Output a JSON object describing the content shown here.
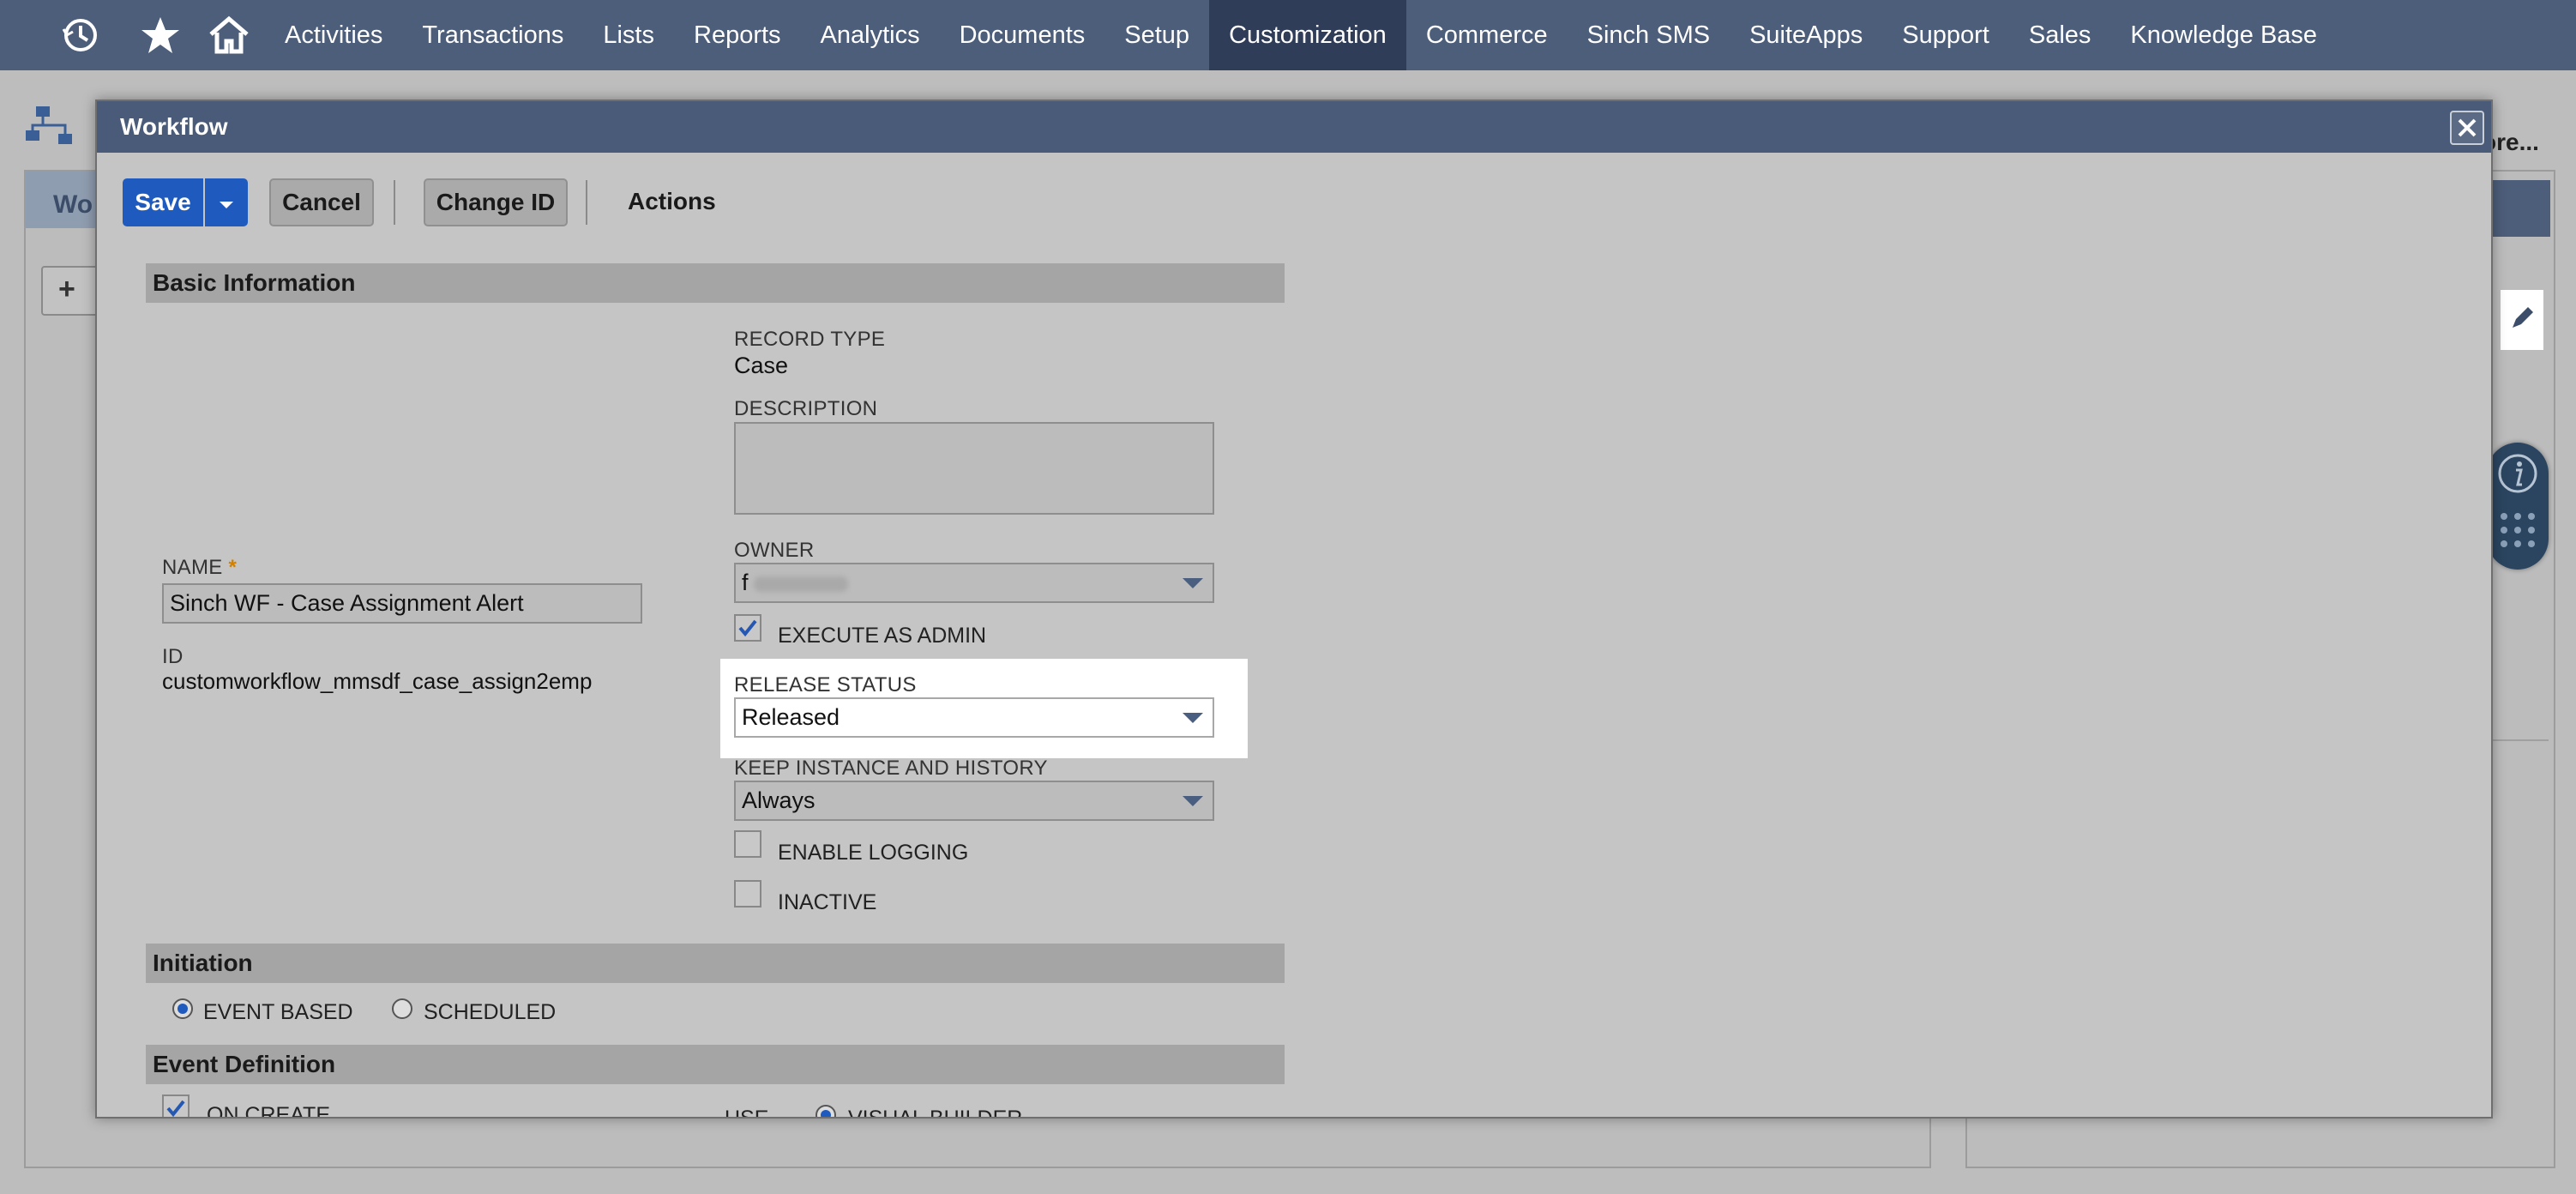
{
  "nav": {
    "items": [
      "Activities",
      "Transactions",
      "Lists",
      "Reports",
      "Analytics",
      "Documents",
      "Setup",
      "Customization",
      "Commerce",
      "Sinch SMS",
      "SuiteApps",
      "Support",
      "Sales",
      "Knowledge Base"
    ],
    "active": "Customization"
  },
  "background": {
    "tab_partial": "Wo",
    "more_partial": "ore..."
  },
  "modal": {
    "title": "Workflow",
    "toolbar": {
      "save": "Save",
      "cancel": "Cancel",
      "change_id": "Change ID",
      "actions": "Actions"
    },
    "sections": {
      "basic": "Basic Information",
      "initiation": "Initiation",
      "event_definition": "Event Definition"
    },
    "fields": {
      "name_label": "NAME",
      "name_required": "*",
      "name_value": "Sinch WF - Case Assignment Alert",
      "id_label": "ID",
      "id_value": "customworkflow_mmsdf_case_assign2emp",
      "record_type_label": "RECORD TYPE",
      "record_type_value": "Case",
      "description_label": "DESCRIPTION",
      "description_value": "",
      "owner_label": "OWNER",
      "owner_value": "f",
      "execute_as_admin": "EXECUTE AS ADMIN",
      "execute_as_admin_checked": true,
      "release_status_label": "RELEASE STATUS",
      "release_status_value": "Released",
      "keep_instance_label": "KEEP INSTANCE AND HISTORY",
      "keep_instance_value": "Always",
      "enable_logging": "ENABLE LOGGING",
      "enable_logging_checked": false,
      "inactive": "INACTIVE",
      "inactive_checked": false
    },
    "initiation": {
      "event_based": "EVENT BASED",
      "scheduled": "SCHEDULED",
      "selected": "EVENT BASED"
    },
    "event_definition": {
      "on_create": "ON CREATE",
      "on_create_checked": true,
      "use_label": "USE",
      "visual_builder": "VISUAL BUILDER"
    }
  },
  "colors": {
    "nav_bg": "#4d5e7a",
    "nav_active": "#2f3d58",
    "primary": "#1f5bbf",
    "modal_title": "#495b78"
  }
}
